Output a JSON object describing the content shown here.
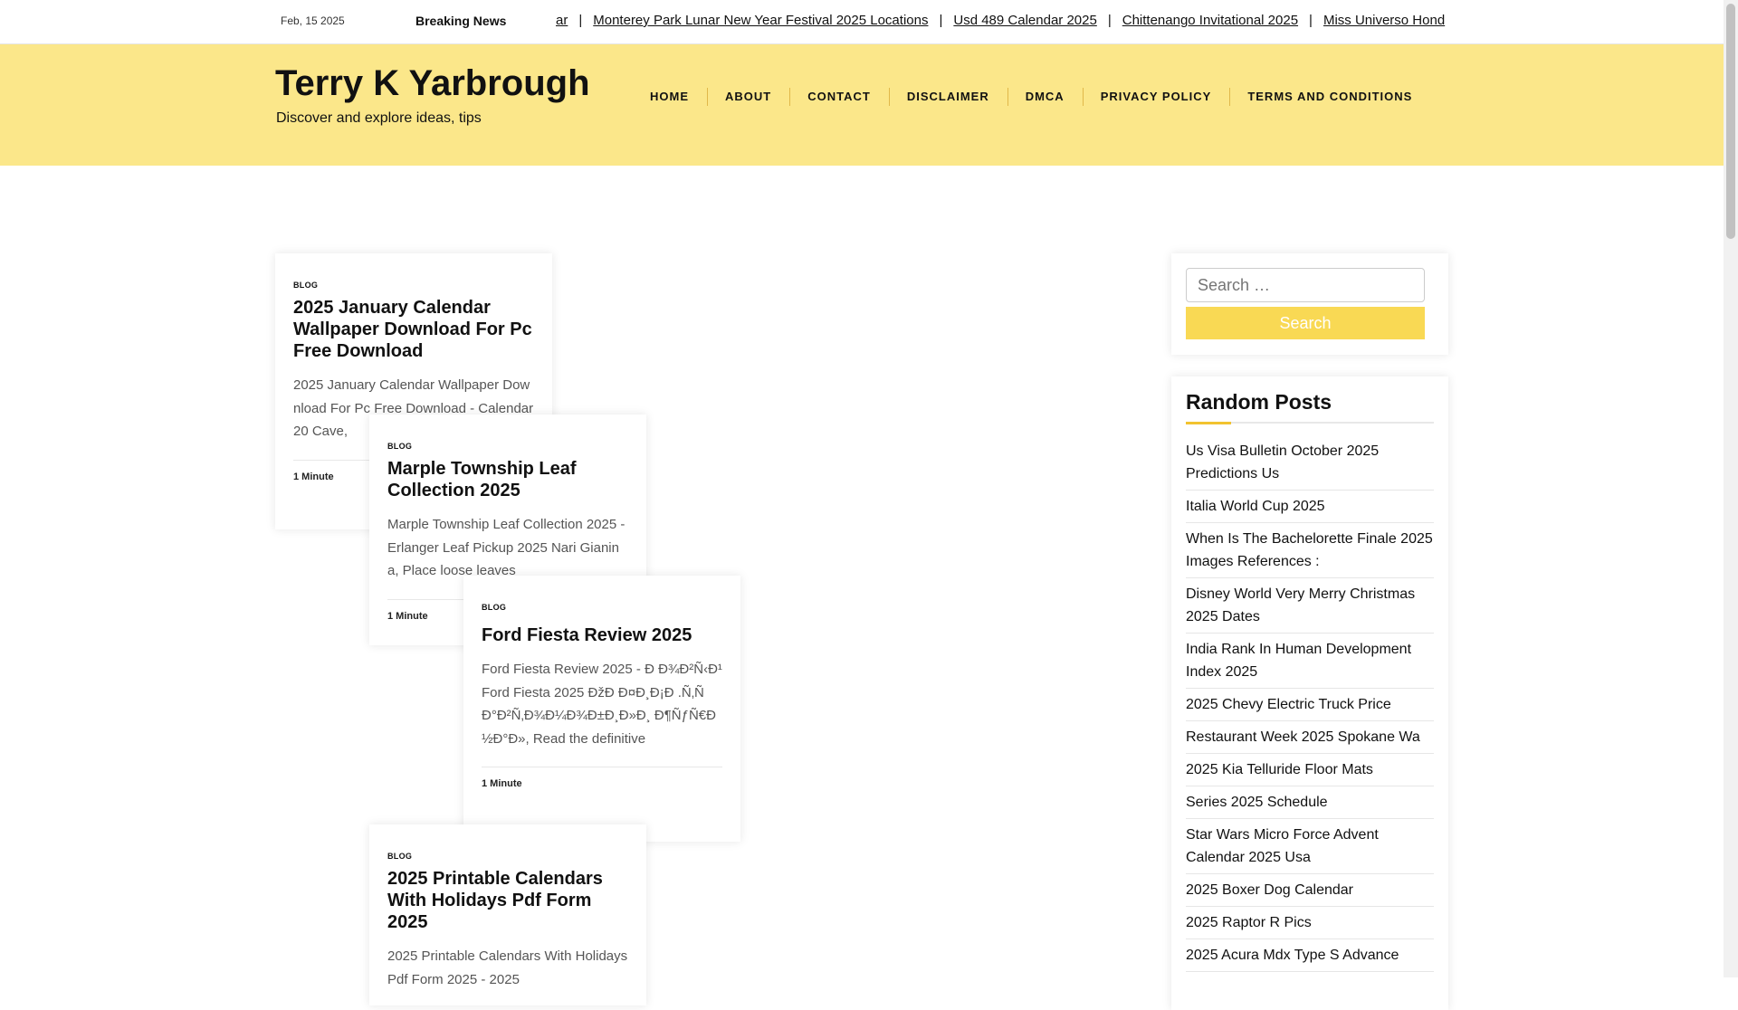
{
  "topbar": {
    "date": "Feb, 15 2025",
    "breaking_label": "Breaking News",
    "ticker": [
      "ar",
      "Monterey Park Lunar New Year Festival 2025 Locations",
      "Usd 489 Calendar 2025",
      "Chittenango Invitational 2025",
      "Miss Universo Hond"
    ]
  },
  "header": {
    "site_title": "Terry K Yarbrough",
    "tagline": "Discover and explore ideas, tips",
    "nav": [
      "HOME",
      "ABOUT",
      "CONTACT",
      "DISCLAIMER",
      "DMCA",
      "PRIVACY POLICY",
      "TERMS AND CONDITIONS"
    ]
  },
  "posts": [
    {
      "category": "BLOG",
      "title": "2025 January Calendar Wallpaper Download For Pc Free Download",
      "excerpt": "2025 January Calendar Wallpaper Download For Pc Free Download - Calendar 20 Cave,",
      "meta": "1 Minute"
    },
    {
      "category": "BLOG",
      "title": "Marple Township Leaf Collection 2025",
      "excerpt": "Marple Township Leaf Collection 2025 - Erlanger Leaf Pickup 2025 Nari Gianina, Place loose leaves",
      "meta": "1 Minute"
    },
    {
      "category": "BLOG",
      "title": "Ford Fiesta Review 2025",
      "excerpt": "Ford Fiesta Review 2025 - Ð    Ð¾Ð²Ñ‹Ð¹ Ford Fiesta 2025 ÐžÐ    Ð¤Ð¸Ð¡Ð    .Ñ‚Ñ Ð°Ð²Ñ‚Ð¾Ð¼Ð¾Ð±Ð¸Ð»Ð¸ Ð¶ÑƒÑ€Ð½Ð°Ð», Read the definitive",
      "meta": "1 Minute"
    },
    {
      "category": "BLOG",
      "title": "2025 Printable Calendars With Holidays Pdf Form 2025",
      "excerpt": "2025 Printable Calendars With Holidays Pdf Form 2025 - 2025",
      "meta": ""
    }
  ],
  "sidebar": {
    "search_placeholder": "Search …",
    "search_button": "Search",
    "random_posts_title": "Random Posts",
    "random_posts": [
      "Us Visa Bulletin October 2025 Predictions Us",
      "Italia World Cup 2025",
      "When Is The Bachelorette Finale 2025 Images References :",
      "Disney World Very Merry Christmas 2025 Dates",
      "India Rank In Human Development Index 2025",
      "2025 Chevy Electric Truck Price",
      "Restaurant Week 2025 Spokane Wa",
      "2025 Kia Telluride Floor Mats",
      "Series 2025 Schedule",
      "Star Wars Micro Force Advent Calendar 2025 Usa",
      "2025 Boxer Dog Calendar",
      "2025 Raptor R Pics",
      "2025 Acura Mdx Type S Advance"
    ]
  },
  "colors": {
    "header_bg": "#fbe78a",
    "accent": "#f9d954",
    "underline_accent": "#f2c32f"
  }
}
